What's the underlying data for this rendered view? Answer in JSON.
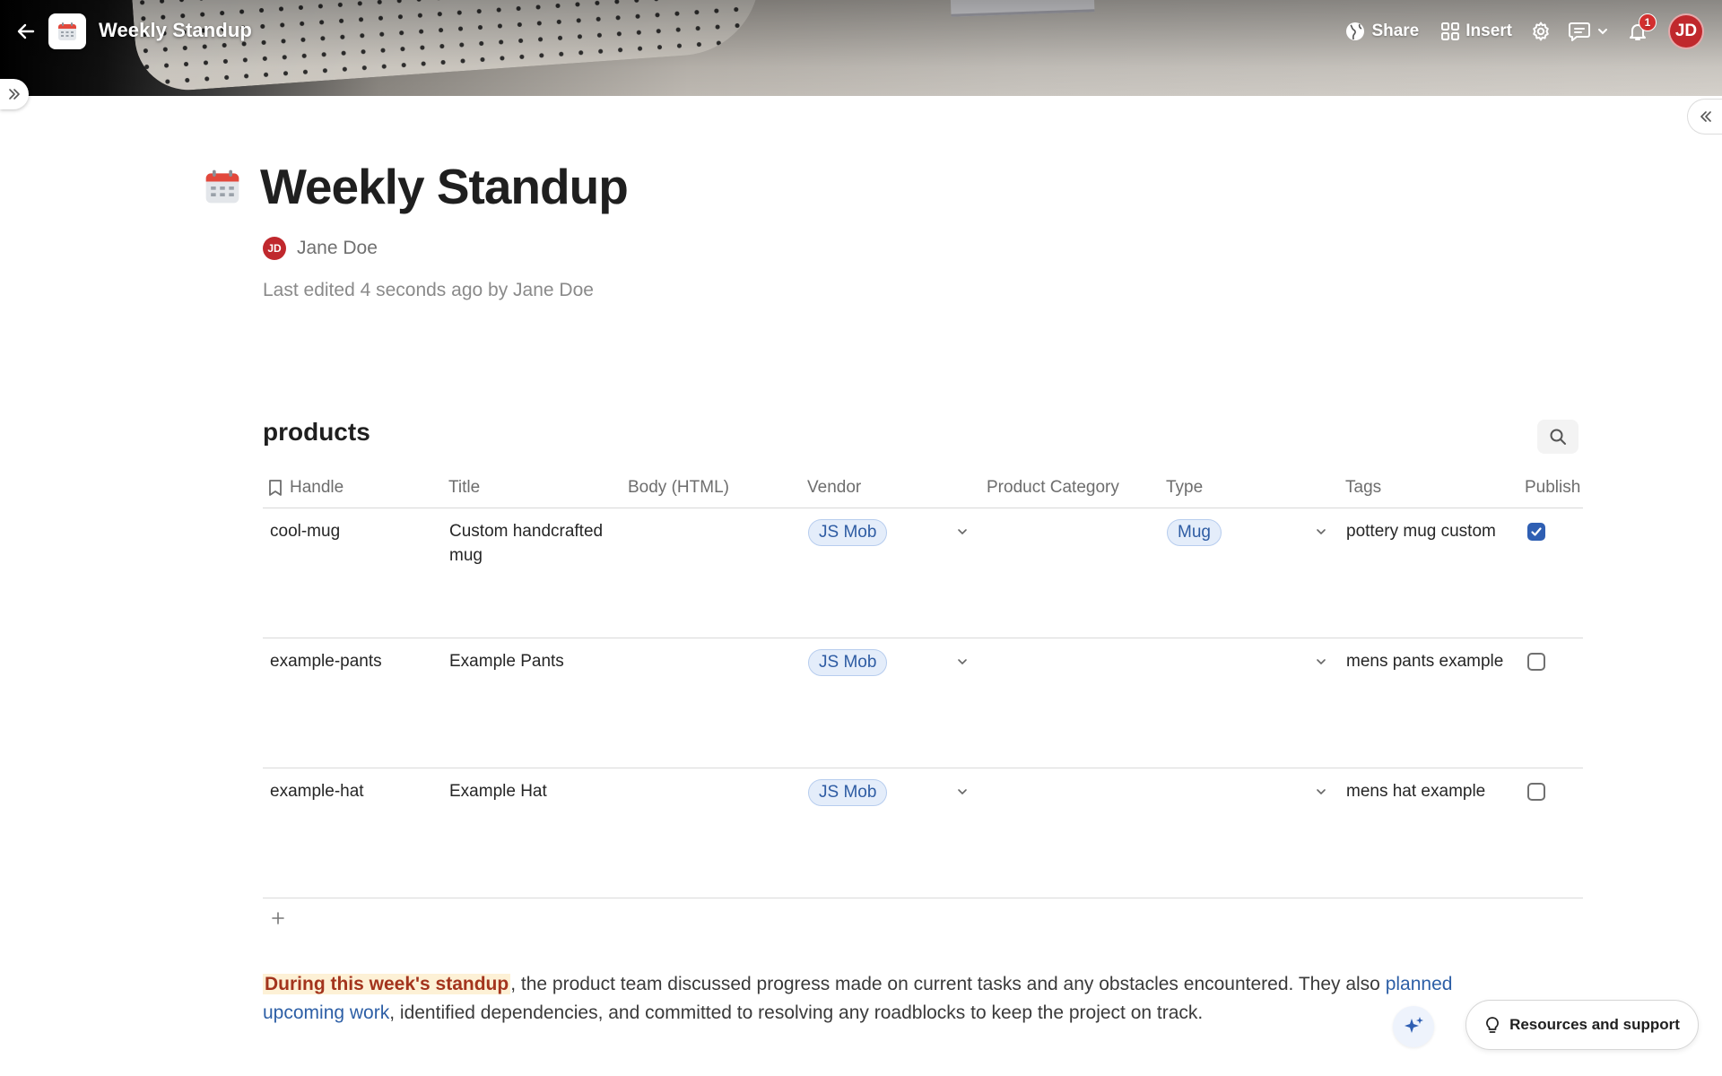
{
  "app": {
    "doc_title": "Weekly Standup"
  },
  "topbar": {
    "share_label": "Share",
    "insert_label": "Insert",
    "notification_count": "1",
    "user_initials": "JD"
  },
  "page": {
    "title": "Weekly Standup",
    "author_initials": "JD",
    "author_name": "Jane Doe",
    "last_edited": "Last edited 4 seconds ago by Jane Doe"
  },
  "table": {
    "title": "products",
    "columns": [
      "Handle",
      "Title",
      "Body (HTML)",
      "Vendor",
      "Product Category",
      "Type",
      "Tags",
      "Publish"
    ],
    "rows": [
      {
        "handle": "cool-mug",
        "title": "Custom handcrafted mug",
        "body": "",
        "vendor": "JS Mob",
        "category": "",
        "type": "Mug",
        "tags": "pottery mug custom",
        "published": true
      },
      {
        "handle": "example-pants",
        "title": "Example Pants",
        "body": "",
        "vendor": "JS Mob",
        "category": "",
        "type": "",
        "tags": "mens pants example",
        "published": false
      },
      {
        "handle": "example-hat",
        "title": "Example Hat",
        "body": "",
        "vendor": "JS Mob",
        "category": "",
        "type": "",
        "tags": "mens hat example",
        "published": false
      }
    ]
  },
  "paragraph": {
    "highlight": "During this week's standup",
    "text1": ", the product team discussed progress made on current tasks and any obstacles encountered. They also ",
    "link": "planned upcoming work",
    "text2": ", identified dependencies, and committed to resolving any roadblocks to keep the project on track."
  },
  "footer": {
    "resources_label": "Resources and support"
  },
  "colors": {
    "accent_blue": "#2f5fb3",
    "avatar_red": "#c0282d",
    "pill_bg": "#e4edfa",
    "highlight_bg": "#fdf1d6",
    "highlight_text": "#a3341d"
  },
  "icons": [
    "back-arrow-icon",
    "calendar-icon",
    "share-globe-icon",
    "insert-grid-icon",
    "gear-icon",
    "comment-icon",
    "chevron-down-icon",
    "bell-icon",
    "double-chevron-right-icon",
    "double-chevron-left-icon",
    "search-icon",
    "bookmark-icon",
    "plus-icon",
    "sparkle-icon",
    "lightbulb-icon"
  ]
}
